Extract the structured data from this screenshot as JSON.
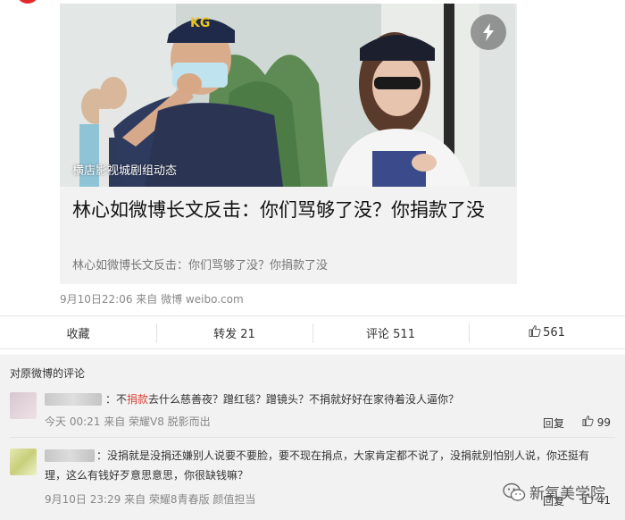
{
  "post": {
    "card": {
      "watermark": "横店影视城剧组动态",
      "title": "林心如微博长文反击：你们骂够了没？你捐款了没",
      "summary": "林心如微博长文反击：你们骂够了没？你捐款了没"
    },
    "meta": "9月10日22:06 来自 微博 weibo.com"
  },
  "actions": {
    "favorite": "收藏",
    "repost": "转发 21",
    "comment": "评论 511",
    "like_count": "561"
  },
  "comments": {
    "header": "对原微博的评论",
    "items": [
      {
        "text_prefix": "：不",
        "text_highlight": "捐款",
        "text_rest": "去什么慈善夜？蹭红毯？蹭镜头？不捐就好好在家待着没人逼你？",
        "meta": "今天 00:21 来自 荣耀V8 脱影而出",
        "reply": "回复",
        "likes": "99"
      },
      {
        "text_line1": "：没捐就是没捐还嫌别人说要不要脸，要不现在捐点，大家肯定都不说了，没捐就别怕别人说，你还挺有",
        "text_line2": "理，这么有钱好歹意思意思，你很缺钱嘛？",
        "meta": "9月10日 23:29 来自 荣耀8青春版 颜值担当",
        "reply": "回复",
        "likes": "41"
      }
    ]
  },
  "brand": {
    "label": "新氧美学院"
  },
  "colors": {
    "highlight": "#d9433b",
    "panel_bg": "#f2f2f2"
  }
}
